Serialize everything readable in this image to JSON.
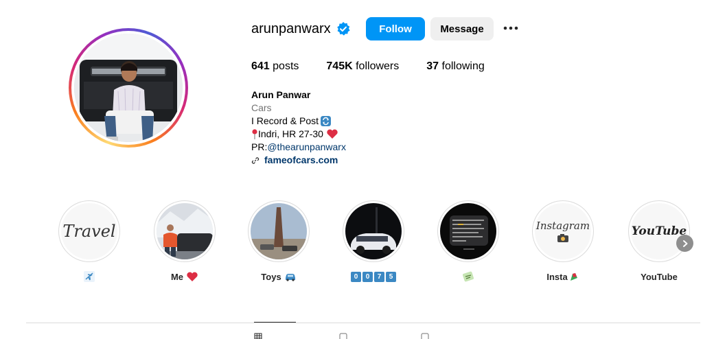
{
  "profile": {
    "username": "arunpanwarx",
    "follow_label": "Follow",
    "message_label": "Message"
  },
  "stats": {
    "posts_count": "641",
    "posts_label": "posts",
    "followers_count": "745K",
    "followers_label": "followers",
    "following_count": "37",
    "following_label": "following"
  },
  "bio": {
    "name": "Arun Panwar",
    "category": "Cars",
    "line1": "I Record & Post",
    "line2": "Indri, HR 27-30",
    "line3_prefix": "PR: ",
    "line3_mention": "@thearunpanwarx",
    "link": "fameofcars.com"
  },
  "highlights": [
    {
      "label": "",
      "cover_text": "Travel",
      "icon": "airplane-emoji"
    },
    {
      "label": "Me",
      "icon": "heart-emoji"
    },
    {
      "label": "Toys",
      "icon": "car-emoji"
    },
    {
      "label": "",
      "digits": [
        "0",
        "0",
        "7",
        "5"
      ]
    },
    {
      "label": "",
      "icon": "sticker-emoji"
    },
    {
      "label": "Insta",
      "cover_text": "Instagram",
      "icon": "emoji"
    },
    {
      "label": "YouTube",
      "cover_text": "YouTube"
    }
  ],
  "colors": {
    "accent": "#0095f6",
    "link": "#00376b",
    "muted": "#737373",
    "verified": "#0095f6"
  }
}
